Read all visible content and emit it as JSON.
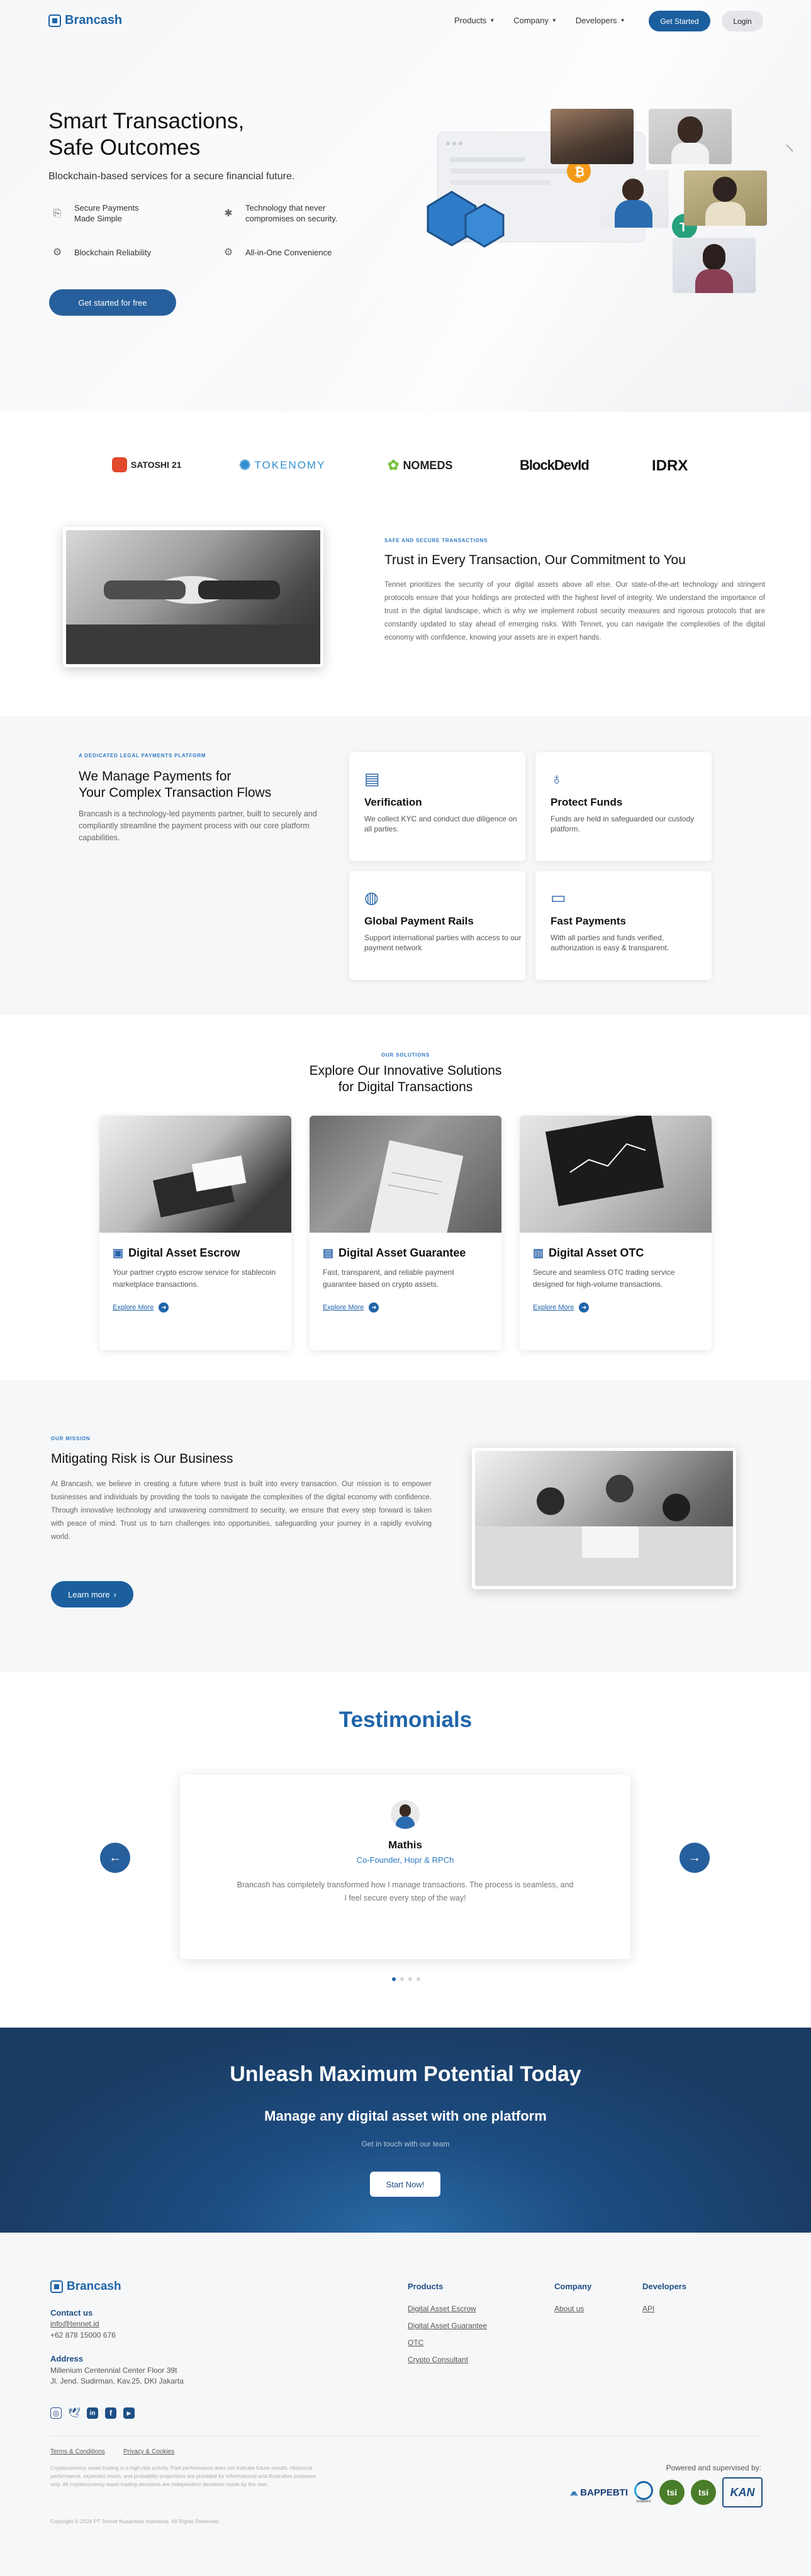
{
  "header": {
    "brand": "Brancash",
    "nav": [
      {
        "label": "Products"
      },
      {
        "label": "Company"
      },
      {
        "label": "Developers"
      }
    ],
    "get_started": "Get Started",
    "login": "Login"
  },
  "hero": {
    "title_line1": "Smart Transactions,",
    "title_line2": "Safe Outcomes",
    "subtitle": "Blockchain-based services for a secure financial future.",
    "features": [
      {
        "icon": "payments-icon",
        "line1": "Secure Payments",
        "line2": "Made Simple"
      },
      {
        "icon": "shield-gear-icon",
        "line1": "Technology that never",
        "line2": "compromises on security."
      },
      {
        "icon": "blockchain-icon",
        "line1": "Blockchain Reliability",
        "line2": ""
      },
      {
        "icon": "gear-icon",
        "line1": "All-in-One Convenience",
        "line2": ""
      }
    ],
    "cta": "Get started for free"
  },
  "partners": [
    {
      "name": "SATOSHI 21",
      "color": "#e2482b"
    },
    {
      "name": "TOKENOMY",
      "color": "#2f8fd1"
    },
    {
      "name": "NOMEDS",
      "color": "#3a3a3a"
    },
    {
      "name": "BlockDevId",
      "color": "#111111"
    },
    {
      "name": "IDRX",
      "color": "#111111"
    }
  ],
  "trust": {
    "eyebrow": "SAFE AND SECURE TRANSACTIONS",
    "title": "Trust in Every Transaction, Our Commitment to You",
    "body": "Tennet prioritizes the security of your digital assets above all else. Our state-of-the-art technology and stringent protocols ensure that your holdings are protected with the highest level of integrity. We understand the importance of trust in the digital landscape, which is why we implement robust security measures and rigorous protocols that are constantly updated to stay ahead of emerging risks. With Tennet, you can navigate the complexities of the digital economy with confidence, knowing your assets are in expert hands."
  },
  "manage": {
    "eyebrow": "A DEDICATED LEGAL PAYMENTS PLATFORM",
    "title_line1": "We Manage Payments for",
    "title_line2": "Your Complex Transaction Flows",
    "body": "Brancash is a technology-led payments partner, built to securely and compliantly streamline the payment process with our core platform capabilities.",
    "cards": [
      {
        "icon": "verification-icon",
        "title": "Verification",
        "desc": "We collect KYC and conduct due diligence on all parties."
      },
      {
        "icon": "protect-funds-icon",
        "title": "Protect Funds",
        "desc": "Funds are held in safeguarded our custody platform."
      },
      {
        "icon": "globe-icon",
        "title": "Global Payment Rails",
        "desc": "Support international parties with access to our payment network"
      },
      {
        "icon": "fast-payment-icon",
        "title": "Fast Payments",
        "desc": "With all parties and funds verified, authorization is easy & transparent."
      }
    ]
  },
  "solutions": {
    "eyebrow": "OUR SOLUTIONS",
    "title_line1": "Explore Our Innovative Solutions",
    "title_line2": "for Digital Transactions",
    "items": [
      {
        "icon": "escrow-icon",
        "title": "Digital Asset Escrow",
        "desc": "Your partner crypto escrow service for stablecoin marketplace transactions.",
        "link": "Explore More"
      },
      {
        "icon": "guarantee-icon",
        "title": "Digital Asset Guarantee",
        "desc": "Fast, transparent, and reliable payment guarantee based on crypto assets.",
        "link": "Explore More"
      },
      {
        "icon": "otc-icon",
        "title": "Digital Asset OTC",
        "desc": "Secure and seamless OTC trading service designed for high-volume transactions.",
        "link": "Explore More"
      }
    ]
  },
  "mission": {
    "eyebrow": "OUR MISSION",
    "title": "Mitigating Risk is Our Business",
    "body": "At Brancash, we believe in creating a future where trust is built into every transaction. Our mission is to empower businesses and individuals by providing the tools to navigate the complexities of the digital economy with confidence. Through innovative technology and unwavering commitment to security, we ensure that every step forward is taken with peace of mind. Trust us to turn challenges into opportunities, safeguarding your journey in a rapidly evolving world.",
    "cta": "Learn more"
  },
  "testimonials": {
    "title": "Testimonials",
    "name": "Mathis",
    "role": "Co-Founder, Hopr & RPCh",
    "quote": "Brancash has completely transformed how I manage transactions. The process is seamless, and I feel secure every step of the way!"
  },
  "cta": {
    "title": "Unleash Maximum Potential Today",
    "subtitle": "Manage any digital asset with one platform",
    "small": "Get in touch with our team",
    "button": "Start Now!"
  },
  "footer": {
    "brand": "Brancash",
    "contact_h": "Contact us",
    "email": "info@tennet.id",
    "phone": "+62 878 15000 676",
    "address_h": "Address",
    "address1": "Millenium Centennial Center Floor 39t",
    "address2": "Jl. Jend. Sudirman, Kav.25, DKI Jakarta",
    "products_h": "Products",
    "products": [
      "Digital Asset Escrow",
      "Digital Asset Guarantee",
      "OTC",
      "Crypto Consultant"
    ],
    "company_h": "Company",
    "company": [
      "About us"
    ],
    "developers_h": "Developers",
    "developers": [
      "API"
    ],
    "terms": "Terms & Conditions",
    "privacy": "Privacy & Cookies",
    "disclaimer": "Cryptocurrency asset trading is a high-risk activity. Past performance does not indicate future results. Historical performance, expected return, and probability projections are provided for informational and illustrative purposes only. All cryptocurrency asset trading decisions are independent decisions made by the user.",
    "copyright": "Copyright © 2024 PT Tennet Nusantara Indonesia. All Rights Reserved.",
    "supervised": "Powered and supervised by:",
    "badges": [
      "BAPPEBTI",
      "KOMINFO",
      "tsi",
      "tsi",
      "KAN"
    ]
  }
}
